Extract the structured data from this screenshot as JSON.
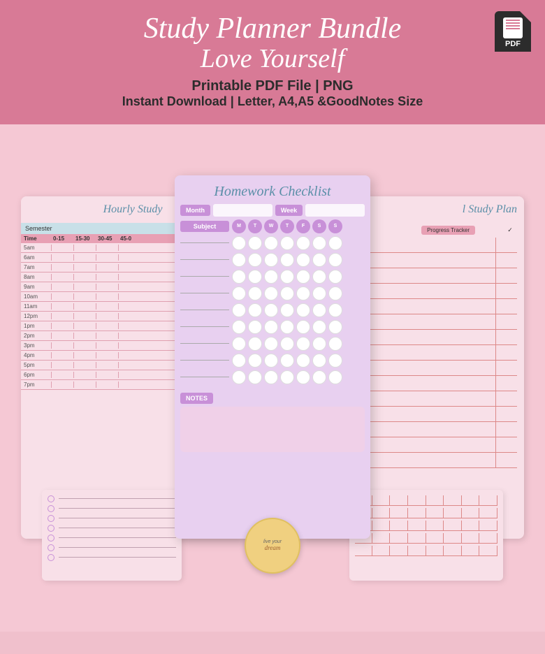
{
  "header": {
    "title1": "Study Planner Bundle",
    "title2": "Love Yourself",
    "sub1": "Printable PDF File | PNG",
    "sub2": "Instant Download | Letter, A4,A5 &GoodNotes Size",
    "pdf_label": "PDF"
  },
  "center_card": {
    "title": "Homework Checklist",
    "month_label": "Month",
    "week_label": "Week",
    "subject_label": "Subject",
    "days": [
      "M",
      "T",
      "W",
      "T",
      "F",
      "S",
      "S"
    ],
    "notes_label": "NOTES"
  },
  "left_card": {
    "title": "Hourly Study",
    "semester_label": "Semester",
    "time_header": [
      "Time",
      "0-15",
      "15-30",
      "30-45",
      "45-0"
    ],
    "times": [
      "5am",
      "6am",
      "7am",
      "8am",
      "9am",
      "10am",
      "11am",
      "12pm",
      "1pm",
      "2pm",
      "3pm",
      "4pm",
      "5pm",
      "6pm",
      "7pm"
    ]
  },
  "right_card": {
    "title": "l Study Plan",
    "progress_label": "Progress Tracker",
    "check_label": "✓"
  },
  "watermark": {
    "line1": "live",
    "line2": "your",
    "line3": "dream"
  },
  "colors": {
    "header_bg": "#d87a96",
    "main_bg": "#f5c8d4",
    "card_purple": "#e8d0f0",
    "card_pink": "#f8e0e8",
    "accent_purple": "#c890d8",
    "accent_blue": "#5b8fa8",
    "accent_pink": "#e8a0b4"
  }
}
